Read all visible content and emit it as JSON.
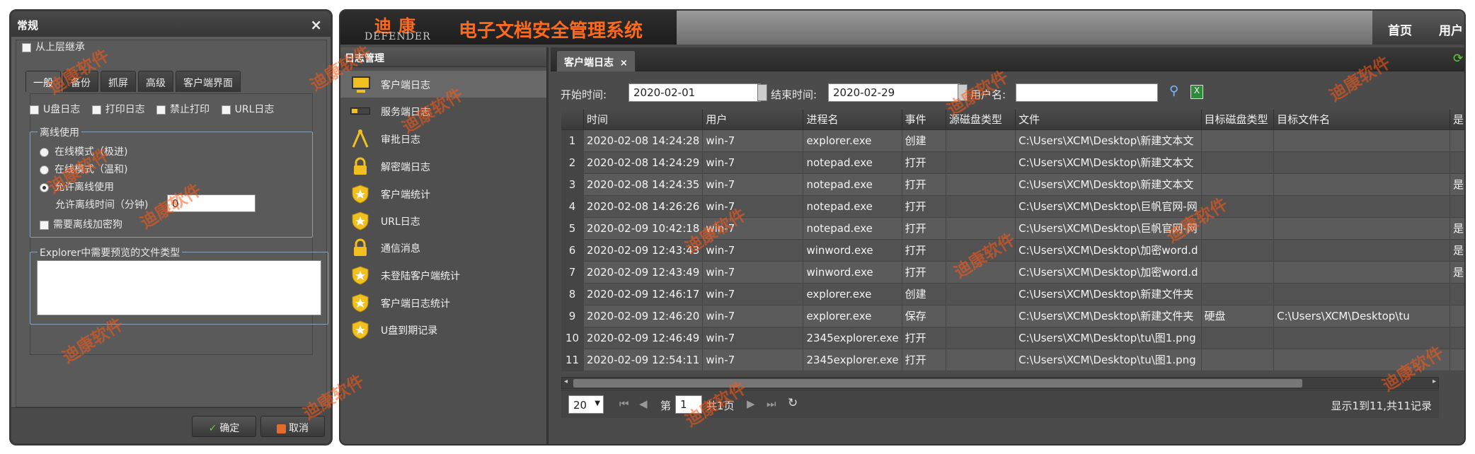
{
  "dialog": {
    "title": "常规",
    "inherit_label": "从上层继承",
    "tabs": [
      "一般",
      "备份",
      "抓屏",
      "高级",
      "客户端界面"
    ],
    "options": [
      "U盘日志",
      "打印日志",
      "禁止打印",
      "URL日志"
    ],
    "offline": {
      "legend": "离线使用",
      "radios": [
        "在线模式（极进)",
        "在线模式（温和)",
        "允许离线使用"
      ],
      "selected": "允许离线使用",
      "time_label": "允许离线时间（分钟)",
      "time_value": "0",
      "need_dog_label": "需要离线加密狗"
    },
    "explorer": {
      "legend": "Explorer中需要预览的文件类型",
      "value": ""
    },
    "ok_label": "确定",
    "cancel_label": "取消"
  },
  "header": {
    "brand_cn": "迪康",
    "brand_en": "DEFENDER",
    "system_title": "电子文档安全管理系统",
    "nav": [
      "首页",
      "用户"
    ]
  },
  "sidebar": {
    "title": "日志管理",
    "items": [
      {
        "label": "客户端日志",
        "icon": "monitor-icon"
      },
      {
        "label": "服务端日志",
        "icon": "server-icon"
      },
      {
        "label": "审批日志",
        "icon": "compass-icon"
      },
      {
        "label": "解密端日志",
        "icon": "lock-icon"
      },
      {
        "label": "客户端统计",
        "icon": "shield-star-icon"
      },
      {
        "label": "URL日志",
        "icon": "shield-star-icon"
      },
      {
        "label": "通信消息",
        "icon": "lock-icon"
      },
      {
        "label": "未登陆客户端统计",
        "icon": "shield-star-icon"
      },
      {
        "label": "客户端日志统计",
        "icon": "shield-star-icon"
      },
      {
        "label": "U盘到期记录",
        "icon": "shield-star-icon"
      }
    ]
  },
  "content": {
    "tab_label": "客户端日志",
    "search": {
      "start_label": "开始时间:",
      "start_value": "2020-02-01",
      "end_label": "结束时间:",
      "end_value": "2020-02-29",
      "user_label": "用户名:",
      "user_value": ""
    },
    "columns": [
      "时间",
      "用户",
      "进程名",
      "事件",
      "源磁盘类型",
      "文件",
      "目标磁盘类型",
      "目标文件名",
      "是"
    ],
    "rows": [
      {
        "n": "1",
        "time": "2020-02-08 14:24:28",
        "user": "win-7",
        "proc": "explorer.exe",
        "event": "创建",
        "src": "",
        "file": "C:\\Users\\XCM\\Desktop\\新建文本文",
        "dst": "",
        "dstfile": "",
        "x": ""
      },
      {
        "n": "2",
        "time": "2020-02-08 14:24:29",
        "user": "win-7",
        "proc": "notepad.exe",
        "event": "打开",
        "src": "",
        "file": "C:\\Users\\XCM\\Desktop\\新建文本文",
        "dst": "",
        "dstfile": "",
        "x": ""
      },
      {
        "n": "3",
        "time": "2020-02-08 14:24:35",
        "user": "win-7",
        "proc": "notepad.exe",
        "event": "打开",
        "src": "",
        "file": "C:\\Users\\XCM\\Desktop\\新建文本文",
        "dst": "",
        "dstfile": "",
        "x": "是"
      },
      {
        "n": "4",
        "time": "2020-02-08 14:26:26",
        "user": "win-7",
        "proc": "notepad.exe",
        "event": "打开",
        "src": "",
        "file": "C:\\Users\\XCM\\Desktop\\巨帆官网-网",
        "dst": "",
        "dstfile": "",
        "x": ""
      },
      {
        "n": "5",
        "time": "2020-02-09 10:42:18",
        "user": "win-7",
        "proc": "notepad.exe",
        "event": "打开",
        "src": "",
        "file": "C:\\Users\\XCM\\Desktop\\巨帆官网-网",
        "dst": "",
        "dstfile": "",
        "x": "是"
      },
      {
        "n": "6",
        "time": "2020-02-09 12:43:43",
        "user": "win-7",
        "proc": "winword.exe",
        "event": "打开",
        "src": "",
        "file": "C:\\Users\\XCM\\Desktop\\加密word.d",
        "dst": "",
        "dstfile": "",
        "x": "是"
      },
      {
        "n": "7",
        "time": "2020-02-09 12:43:49",
        "user": "win-7",
        "proc": "winword.exe",
        "event": "打开",
        "src": "",
        "file": "C:\\Users\\XCM\\Desktop\\加密word.d",
        "dst": "",
        "dstfile": "",
        "x": "是"
      },
      {
        "n": "8",
        "time": "2020-02-09 12:46:17",
        "user": "win-7",
        "proc": "explorer.exe",
        "event": "创建",
        "src": "",
        "file": "C:\\Users\\XCM\\Desktop\\新建文件夹",
        "dst": "",
        "dstfile": "",
        "x": ""
      },
      {
        "n": "9",
        "time": "2020-02-09 12:46:20",
        "user": "win-7",
        "proc": "explorer.exe",
        "event": "保存",
        "src": "",
        "file": "C:\\Users\\XCM\\Desktop\\新建文件夹",
        "dst": "硬盘",
        "dstfile": "C:\\Users\\XCM\\Desktop\\tu",
        "x": ""
      },
      {
        "n": "10",
        "time": "2020-02-09 12:46:49",
        "user": "win-7",
        "proc": "2345explorer.exe",
        "event": "打开",
        "src": "",
        "file": "C:\\Users\\XCM\\Desktop\\tu\\图1.png",
        "dst": "",
        "dstfile": "",
        "x": ""
      },
      {
        "n": "11",
        "time": "2020-02-09 12:54:11",
        "user": "win-7",
        "proc": "2345explorer.exe",
        "event": "打开",
        "src": "",
        "file": "C:\\Users\\XCM\\Desktop\\tu\\图1.png",
        "dst": "",
        "dstfile": "",
        "x": ""
      }
    ],
    "pager": {
      "page_size": "20",
      "page_prefix": "第",
      "page_value": "1",
      "page_total": "共1页",
      "summary": "显示1到11,共11记录"
    }
  },
  "watermark": "迪康软件",
  "colors": {
    "accent": "#ff6a1a",
    "panel": "#4b4b4b",
    "header": "#1d1d1d"
  }
}
